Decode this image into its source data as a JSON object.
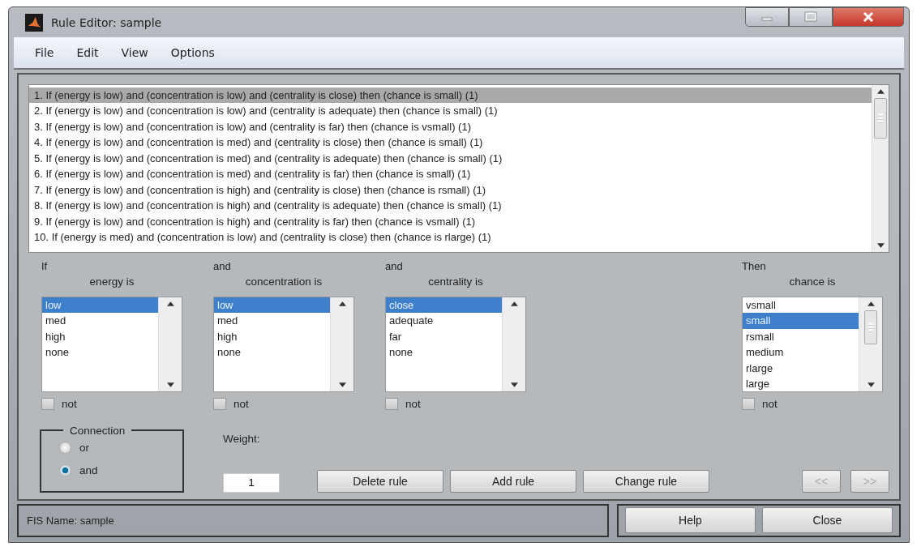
{
  "window": {
    "title": "Rule Editor: sample"
  },
  "menu": [
    "File",
    "Edit",
    "View",
    "Options"
  ],
  "rules": [
    {
      "text": "1. If (energy is low) and (concentration is low) and (centrality is close) then (chance is small) (1)",
      "selected": true
    },
    {
      "text": "2. If (energy is low) and (concentration is low) and (centrality is adequate) then (chance is small) (1)",
      "selected": false
    },
    {
      "text": "3. If (energy is low) and (concentration is low) and (centrality is far) then (chance is vsmall) (1)",
      "selected": false
    },
    {
      "text": "4. If (energy is low) and (concentration is med) and (centrality is close) then (chance is small) (1)",
      "selected": false
    },
    {
      "text": "5. If (energy is low) and (concentration is med) and (centrality is adequate) then (chance is small) (1)",
      "selected": false
    },
    {
      "text": "6. If (energy is low) and (concentration is med) and (centrality is far) then (chance is small) (1)",
      "selected": false
    },
    {
      "text": "7. If (energy is low) and (concentration is high) and (centrality is close) then (chance is rsmall) (1)",
      "selected": false
    },
    {
      "text": "8. If (energy is low) and (concentration is high) and (centrality is adequate) then (chance is small) (1)",
      "selected": false
    },
    {
      "text": "9. If (energy is low) and (concentration is high) and (centrality is far) then (chance is vsmall) (1)",
      "selected": false
    },
    {
      "text": "10. If (energy is med) and (concentration is low) and (centrality is close) then (chance is rlarge) (1)",
      "selected": false
    }
  ],
  "variables": [
    {
      "kind": "input",
      "connective": "If",
      "label": "energy is",
      "options": [
        {
          "label": "low",
          "selected": true
        },
        {
          "label": "med",
          "selected": false
        },
        {
          "label": "high",
          "selected": false
        },
        {
          "label": "none",
          "selected": false
        }
      ],
      "not_label": "not",
      "not_checked": false
    },
    {
      "kind": "input",
      "connective": "and",
      "label": "concentration is",
      "options": [
        {
          "label": "low",
          "selected": true
        },
        {
          "label": "med",
          "selected": false
        },
        {
          "label": "high",
          "selected": false
        },
        {
          "label": "none",
          "selected": false
        }
      ],
      "not_label": "not",
      "not_checked": false
    },
    {
      "kind": "input",
      "connective": "and",
      "label": "centrality is",
      "options": [
        {
          "label": "close",
          "selected": true
        },
        {
          "label": "adequate",
          "selected": false
        },
        {
          "label": "far",
          "selected": false
        },
        {
          "label": "none",
          "selected": false
        }
      ],
      "not_label": "not",
      "not_checked": false
    },
    {
      "kind": "output",
      "connective": "Then",
      "label": "chance is",
      "options": [
        {
          "label": "vsmall",
          "selected": false
        },
        {
          "label": "small",
          "selected": true
        },
        {
          "label": "rsmall",
          "selected": false
        },
        {
          "label": "medium",
          "selected": false
        },
        {
          "label": "rlarge",
          "selected": false
        },
        {
          "label": "large",
          "selected": false
        }
      ],
      "not_label": "not",
      "not_checked": false
    }
  ],
  "connection": {
    "title": "Connection",
    "options": [
      {
        "label": "or",
        "selected": false
      },
      {
        "label": "and",
        "selected": true
      }
    ]
  },
  "weight": {
    "label": "Weight:",
    "value": "1"
  },
  "rule_buttons": [
    "Delete rule",
    "Add rule",
    "Change rule"
  ],
  "nav_buttons": [
    {
      "label": "<<",
      "disabled": true
    },
    {
      "label": ">>",
      "disabled": true
    }
  ],
  "status": "FIS Name: sample",
  "footer_buttons": [
    "Help",
    "Close"
  ]
}
